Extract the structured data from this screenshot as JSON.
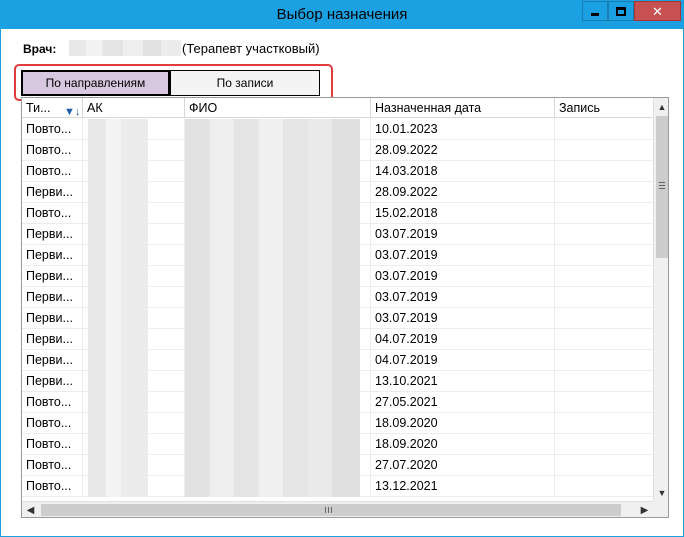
{
  "window": {
    "title": "Выбор назначения",
    "close_glyph": "✕"
  },
  "doctor": {
    "label": "Врач:",
    "role": "(Терапевт участковый)"
  },
  "tabs": [
    {
      "label": "По направлениям",
      "selected": true
    },
    {
      "label": "По записи",
      "selected": false
    }
  ],
  "grid": {
    "columns": [
      {
        "label": "Ти..."
      },
      {
        "label": "АК"
      },
      {
        "label": "ФИО"
      },
      {
        "label": "Назначенная дата"
      },
      {
        "label": "Запись"
      }
    ],
    "sort_icon": "filter-sort-icon",
    "rows": [
      {
        "type": "Повто...",
        "date": "10.01.2023"
      },
      {
        "type": "Повто...",
        "date": "28.09.2022"
      },
      {
        "type": "Повто...",
        "date": "14.03.2018"
      },
      {
        "type": "Перви...",
        "date": "28.09.2022"
      },
      {
        "type": "Повто...",
        "date": "15.02.2018"
      },
      {
        "type": "Перви...",
        "date": "03.07.2019"
      },
      {
        "type": "Перви...",
        "date": "03.07.2019"
      },
      {
        "type": "Перви...",
        "date": "03.07.2019"
      },
      {
        "type": "Перви...",
        "date": "03.07.2019"
      },
      {
        "type": "Перви...",
        "date": "03.07.2019"
      },
      {
        "type": "Перви...",
        "date": "04.07.2019"
      },
      {
        "type": "Перви...",
        "date": "04.07.2019"
      },
      {
        "type": "Перви...",
        "date": "13.10.2021"
      },
      {
        "type": "Повто...",
        "date": "27.05.2021"
      },
      {
        "type": "Повто...",
        "date": "18.09.2020"
      },
      {
        "type": "Повто...",
        "date": "18.09.2020"
      },
      {
        "type": "Повто...",
        "date": "27.07.2020"
      },
      {
        "type": "Повто...",
        "date": "13.12.2021"
      }
    ]
  },
  "scrollbars": {
    "up_glyph": "▲",
    "down_glyph": "▼",
    "left_glyph": "◀",
    "right_glyph": "▶"
  }
}
